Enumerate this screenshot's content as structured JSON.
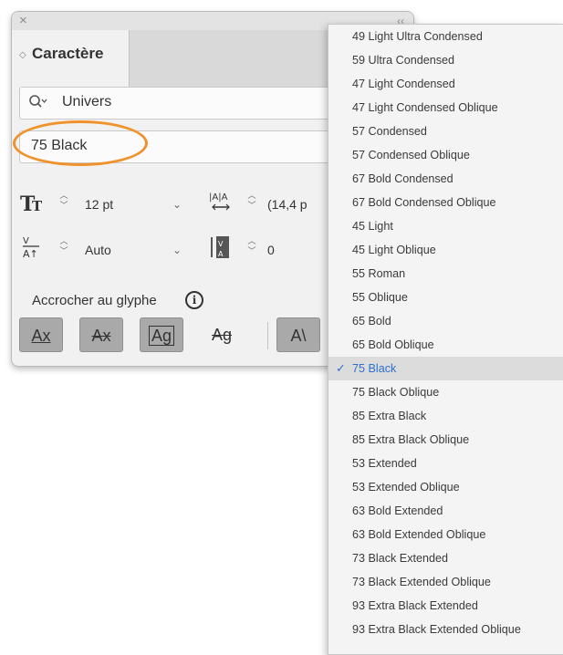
{
  "panel": {
    "title": "Caractère",
    "close_glyph": "×",
    "collapse_glyph": "‹‹",
    "font_family": "Univers",
    "font_style": "75 Black",
    "font_size": "12 pt",
    "leading": "(14,4 p",
    "kerning": "Auto",
    "tracking": "0",
    "snap_label": "Accrocher au glyphe",
    "glyph_buttons": [
      "Ax",
      "Ax",
      "Ag",
      "Ag",
      "A"
    ],
    "highlight_color": "#f0922b"
  },
  "menu": {
    "selected_index": 14,
    "items": [
      "49 Light Ultra Condensed",
      "59 Ultra Condensed",
      "47 Light Condensed",
      "47 Light Condensed Oblique",
      "57 Condensed",
      "57 Condensed Oblique",
      "67 Bold Condensed",
      "67 Bold Condensed Oblique",
      "45 Light",
      "45 Light Oblique",
      "55 Roman",
      "55 Oblique",
      "65 Bold",
      "65 Bold Oblique",
      "75 Black",
      "75 Black Oblique",
      "85 Extra Black",
      "85 Extra Black Oblique",
      "53 Extended",
      "53 Extended Oblique",
      "63 Bold Extended",
      "63 Bold Extended Oblique",
      "73 Black Extended",
      "73 Black Extended Oblique",
      "93 Extra Black Extended",
      "93 Extra Black Extended Oblique"
    ]
  }
}
